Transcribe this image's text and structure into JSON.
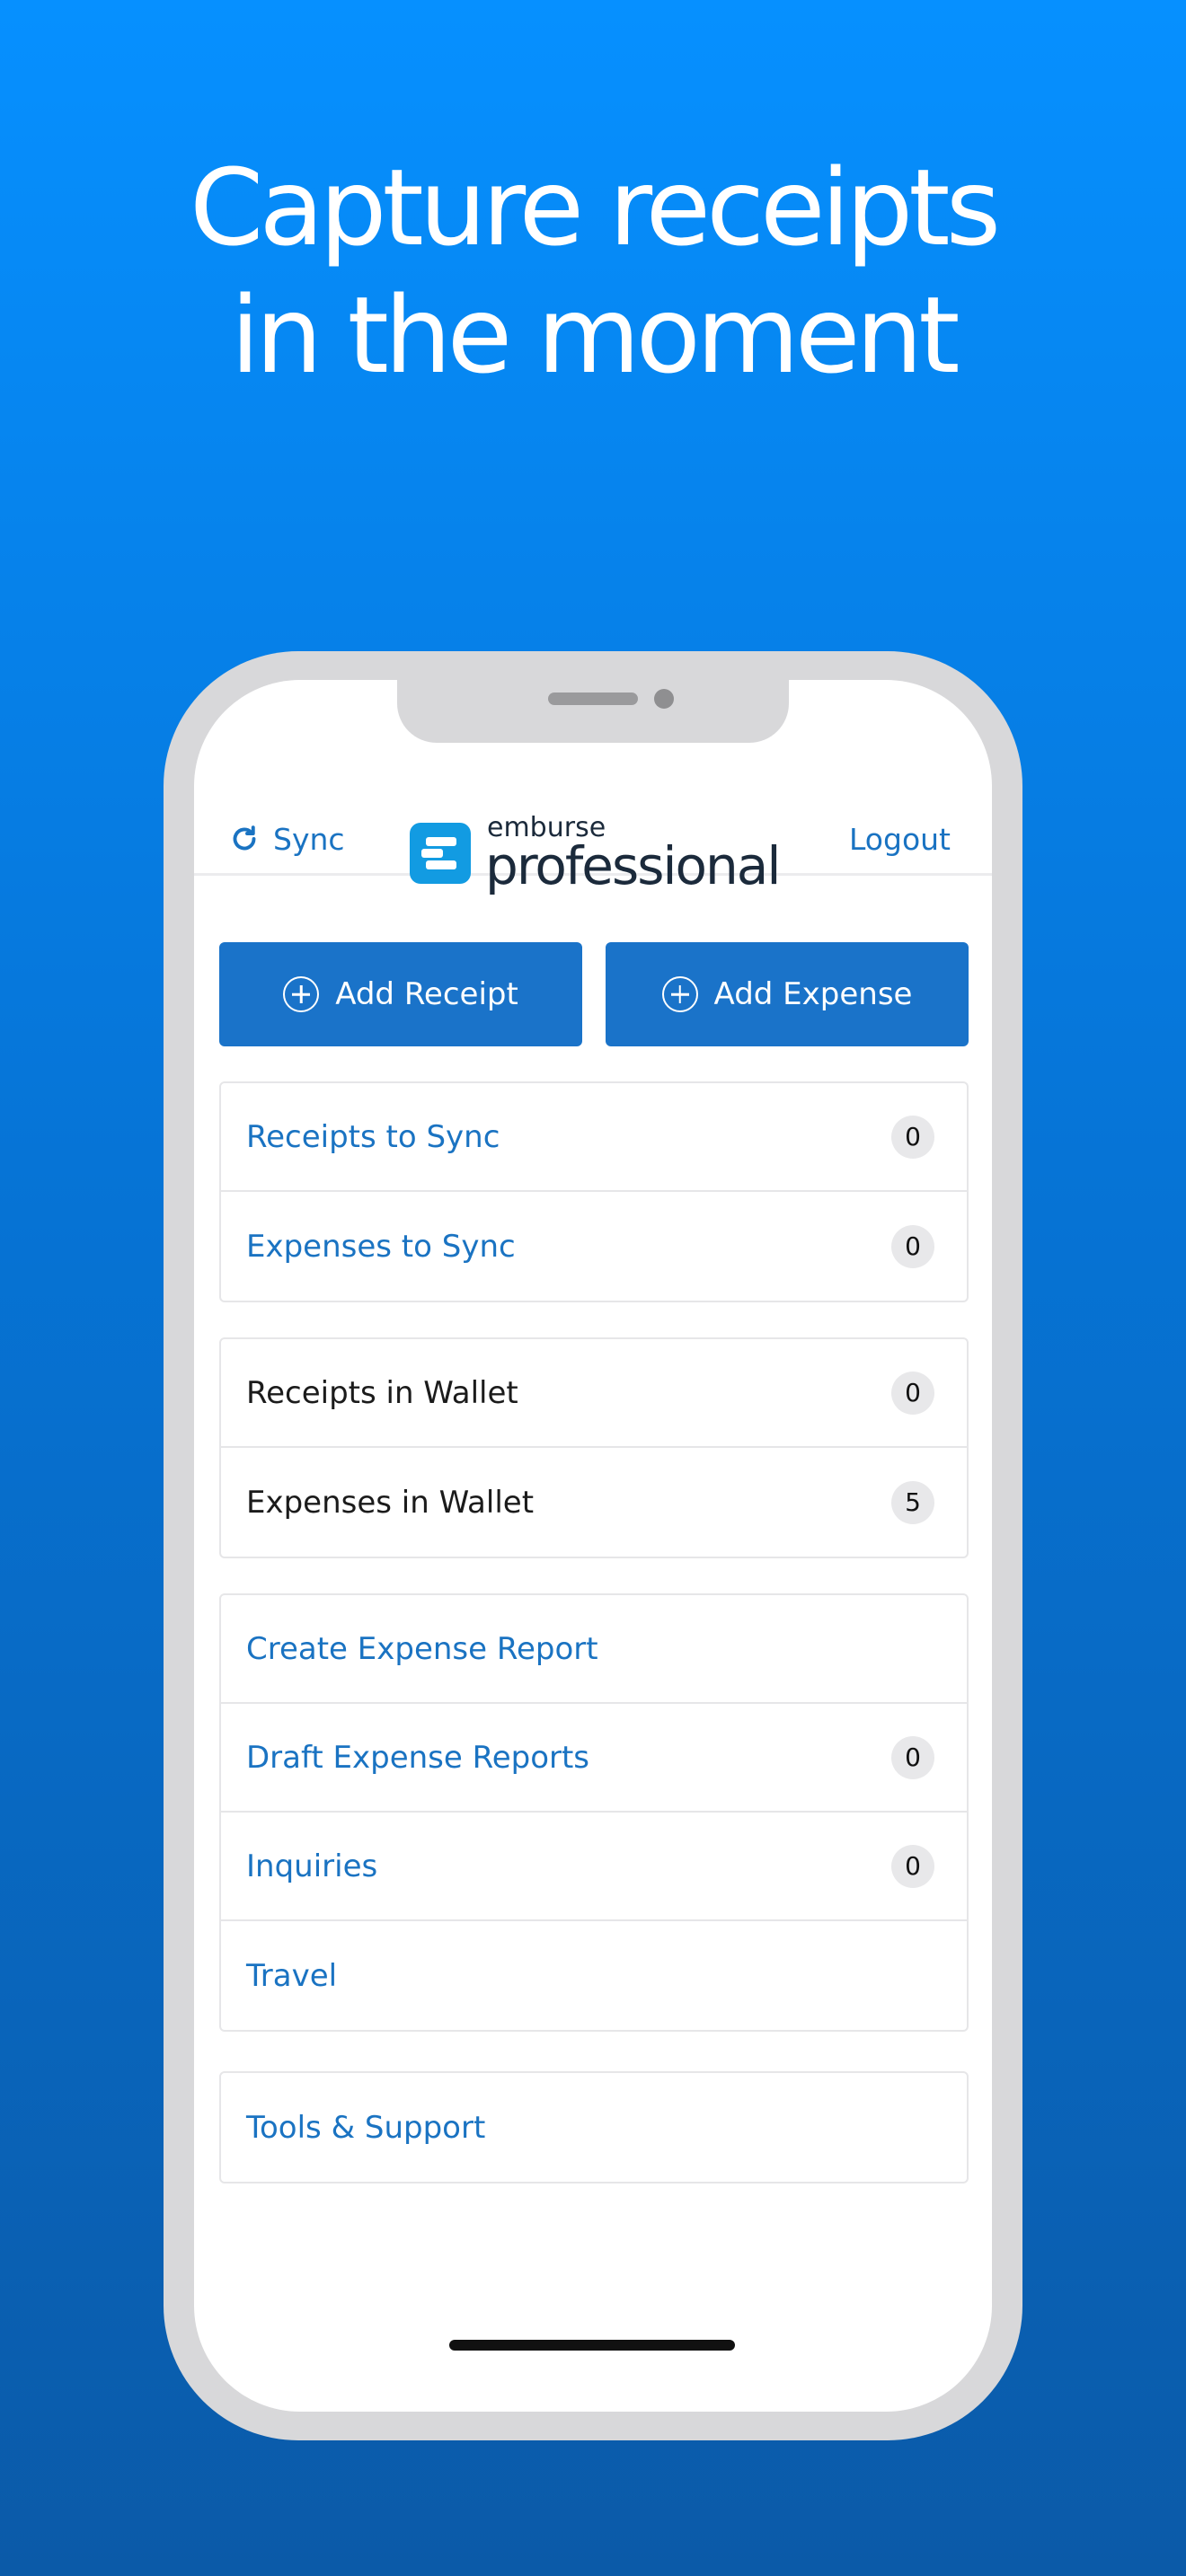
{
  "headline": [
    "Capture receipts",
    "in the moment"
  ],
  "header": {
    "sync_label": "Sync",
    "logo_small": "emburse",
    "logo_big": "professional",
    "logout_label": "Logout"
  },
  "buttons": {
    "add_receipt": "Add Receipt",
    "add_expense": "Add Expense"
  },
  "groups": [
    [
      {
        "label": "Receipts to Sync",
        "count": "0",
        "link": true
      },
      {
        "label": "Expenses to Sync",
        "count": "0",
        "link": true
      }
    ],
    [
      {
        "label": "Receipts in Wallet",
        "count": "0",
        "link": false
      },
      {
        "label": "Expenses in Wallet",
        "count": "5",
        "link": false
      }
    ],
    [
      {
        "label": "Create Expense Report",
        "count": null,
        "link": true
      },
      {
        "label": "Draft Expense Reports",
        "count": "0",
        "link": true
      },
      {
        "label": "Inquiries",
        "count": "0",
        "link": true
      },
      {
        "label": "Travel",
        "count": null,
        "link": true
      }
    ],
    [
      {
        "label": "Tools & Support",
        "count": null,
        "link": true
      }
    ]
  ],
  "colors": {
    "accent": "#1a73c2",
    "button": "#1a73c9",
    "logo_mark": "#129be2",
    "background_top": "#0690ff",
    "background_bottom": "#0b5aa8"
  }
}
